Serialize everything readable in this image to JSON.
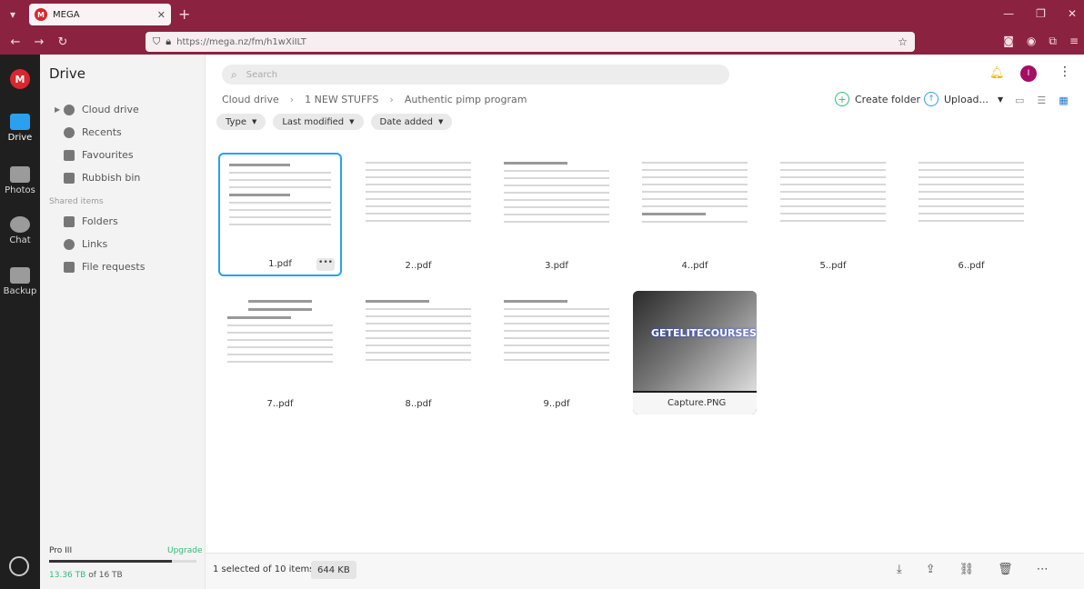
{
  "browser": {
    "tab_title": "MEGA",
    "url": "https://mega.nz/fm/h1wXiILT"
  },
  "iconbar": [
    {
      "label": "Drive",
      "active": true
    },
    {
      "label": "Photos",
      "active": false
    },
    {
      "label": "Chat",
      "active": false
    },
    {
      "label": "Backup",
      "active": false
    }
  ],
  "sidebar": {
    "title": "Drive",
    "items": [
      "Cloud drive",
      "Recents",
      "Favourites",
      "Rubbish bin"
    ],
    "shared_section": "Shared items",
    "shared_items": [
      "Folders",
      "Links",
      "File requests"
    ],
    "plan": "Pro III",
    "upgrade": "Upgrade",
    "storage_used": "13.36 TB",
    "storage_total": "of 16 TB",
    "storage_fraction": 0.835
  },
  "toolbar": {
    "search_placeholder": "Search",
    "avatar_initial": "I",
    "create_folder": "Create folder",
    "upload": "Upload..."
  },
  "breadcrumb": [
    "Cloud drive",
    "1 NEW STUFFS",
    "Authentic pimp program"
  ],
  "filters": [
    "Type",
    "Last modified",
    "Date added"
  ],
  "files": [
    {
      "name": "1.pdf",
      "selected": true
    },
    {
      "name": "2..pdf",
      "selected": false
    },
    {
      "name": "3.pdf",
      "selected": false
    },
    {
      "name": "4..pdf",
      "selected": false
    },
    {
      "name": "5..pdf",
      "selected": false
    },
    {
      "name": "6..pdf",
      "selected": false
    },
    {
      "name": "7..pdf",
      "selected": false
    },
    {
      "name": "8..pdf",
      "selected": false
    },
    {
      "name": "9..pdf",
      "selected": false
    },
    {
      "name": "Capture.PNG",
      "selected": false
    }
  ],
  "image_brand_text": "GETELITECOURSES.COM",
  "footer": {
    "selection": "1 selected of 10 items",
    "size": "644 KB"
  }
}
